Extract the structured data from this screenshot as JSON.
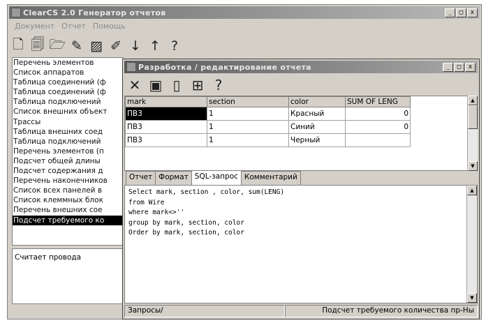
{
  "main_window": {
    "title": "ClearCS 2.0 Генератор отчетов",
    "controls": [
      "_",
      "□",
      "x"
    ],
    "menu": [
      "Документ",
      "Отчет",
      "Помощь"
    ],
    "toolbar_icons": [
      {
        "name": "new-document-icon",
        "glyph": "🗋"
      },
      {
        "name": "preview-icon",
        "glyph": "🗐"
      },
      {
        "name": "open-icon",
        "glyph": "🗁"
      },
      {
        "name": "edit-icon",
        "glyph": "✎"
      },
      {
        "name": "delete-icon",
        "glyph": "▨"
      },
      {
        "name": "attach-icon",
        "glyph": "✐"
      },
      {
        "name": "move-down-icon",
        "glyph": "↓"
      },
      {
        "name": "move-up-icon",
        "glyph": "↑"
      },
      {
        "name": "help-icon",
        "glyph": "?"
      }
    ]
  },
  "report_list": {
    "items": [
      "Перечень элементов",
      "Список аппаратов",
      "Таблица соединений (ф",
      "Таблица соединений (ф",
      "Таблица подключений",
      "Список внешних объект",
      "Трассы",
      "Таблица внешних соед",
      "Таблица подключений",
      "Перечень элементов (п",
      "Подсчет общей длины",
      "Подсчет содержания д",
      "Перечень наконечников",
      "Список всех панелей в",
      "Список клеммных блок",
      "Перечень внешних сое",
      "Подсчет требуемого ко"
    ],
    "selected_index": 16,
    "description": "Считает провода"
  },
  "dialog": {
    "title": "Разработка / редактирование отчета",
    "controls": [
      "_",
      "□",
      "x"
    ],
    "toolbar_icons": [
      {
        "name": "close-icon",
        "glyph": "✕"
      },
      {
        "name": "save-icon",
        "glyph": "▣"
      },
      {
        "name": "clear-icon",
        "glyph": "▯"
      },
      {
        "name": "table-view-icon",
        "glyph": "⊞"
      },
      {
        "name": "help-icon",
        "glyph": "?"
      }
    ],
    "grid": {
      "columns": [
        "mark",
        "section",
        "color",
        "SUM OF LENG"
      ],
      "rows": [
        [
          "ПВ3",
          "1",
          "Красный",
          "0"
        ],
        [
          "ПВ3",
          "1",
          "Синий",
          "0"
        ],
        [
          "ПВ3",
          "1",
          "Черный",
          ""
        ]
      ]
    },
    "tabs": [
      "Отчет",
      "Формат",
      "SQL-запрос",
      "Комментарий"
    ],
    "active_tab": 2,
    "sql_lines": [
      "Select mark, section , color, sum(LENG)",
      "from Wire",
      "where mark<>''",
      "group by mark, section, color",
      "Order by mark, section, color"
    ],
    "status": {
      "left": "Запросы/",
      "right": "Подсчет требуемого количества пр-Ны"
    }
  }
}
